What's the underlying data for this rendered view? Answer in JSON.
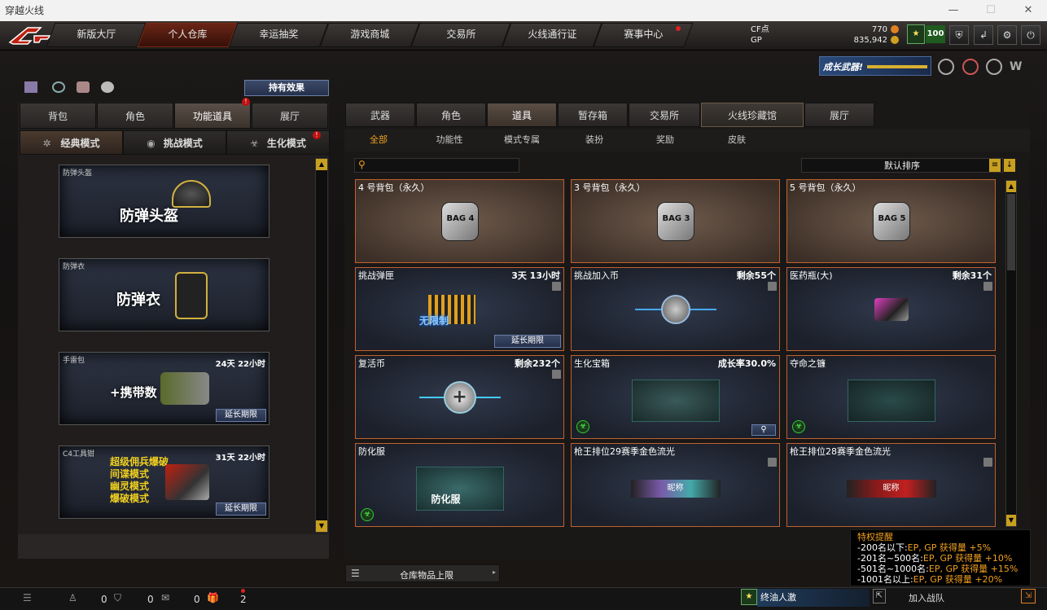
{
  "window": {
    "title": "穿越火线"
  },
  "nav": {
    "tabs": [
      "新版大厅",
      "个人仓库",
      "幸运抽奖",
      "游戏商城",
      "交易所",
      "火线通行证",
      "赛事中心"
    ],
    "active": 1
  },
  "stats": {
    "cf_label": "CF点",
    "cf_value": "770",
    "gp_label": "GP",
    "gp_value": "835,942",
    "level": "100"
  },
  "banner": {
    "text": "成长武器!"
  },
  "left": {
    "effect_button": "持有效果",
    "tabs": [
      "背包",
      "角色",
      "功能道具",
      "展厅"
    ],
    "mode_tabs": [
      "经典模式",
      "挑战模式",
      "生化模式"
    ],
    "items": [
      {
        "label": "防弹头盔",
        "big": "防弹头盔",
        "time": "",
        "extend": ""
      },
      {
        "label": "防弹衣",
        "big": "防弹衣",
        "time": "",
        "extend": ""
      },
      {
        "label": "手雷包",
        "big": "+携带数",
        "time": "24天 22小时",
        "extend": "延长期限"
      },
      {
        "label": "C4工具钳",
        "lines": [
          "超级佣兵爆破",
          "间谍模式",
          "幽灵模式",
          "爆破模式"
        ],
        "time": "31天 22小时",
        "extend": "延长期限"
      }
    ]
  },
  "right": {
    "tabs": [
      "武器",
      "角色",
      "道具",
      "暂存箱",
      "交易所",
      "火线珍藏馆",
      "展厅"
    ],
    "subtabs": [
      "全部",
      "功能性",
      "模式专属",
      "装扮",
      "奖励",
      "皮肤"
    ],
    "sort": "默认排序",
    "search_placeholder": "",
    "cards": [
      {
        "name": "4 号背包（永久）",
        "right": "",
        "badge": "BAG 4"
      },
      {
        "name": "3 号背包（永久）",
        "right": "",
        "badge": "BAG 3"
      },
      {
        "name": "5 号背包（永久）",
        "right": "",
        "badge": "BAG 5"
      },
      {
        "name": "挑战弹匣",
        "right": "3天 13小时",
        "extra": "无限制",
        "action": "延长期限"
      },
      {
        "name": "挑战加入币",
        "right": "剩余55个"
      },
      {
        "name": "医药瓶(大)",
        "right": "剩余31个"
      },
      {
        "name": "复活币",
        "right": "剩余232个"
      },
      {
        "name": "生化宝箱",
        "right": "成长率30.0%"
      },
      {
        "name": "夺命之镰",
        "right": ""
      },
      {
        "name": "防化服",
        "right": "",
        "extra": "防化服"
      },
      {
        "name": "枪王排位29赛季金色流光",
        "right": "",
        "extra": "昵称"
      },
      {
        "name": "枪王排位28赛季金色流光",
        "right": "",
        "extra": "昵称"
      }
    ],
    "storage_limit": "仓库物品上限"
  },
  "tip": {
    "title": "特权提醒",
    "lines": [
      {
        "a": "-200名以下:",
        "b": "EP, GP 获得量 +5%"
      },
      {
        "a": "-201名~500名:",
        "b": "EP, GP 获得量 +10%"
      },
      {
        "a": "-501名~1000名:",
        "b": "EP, GP 获得量 +15%"
      },
      {
        "a": "-1001名以上:",
        "b": "EP, GP 获得量 +20%"
      }
    ]
  },
  "bottom": {
    "counts": [
      "0",
      "0",
      "0",
      "2"
    ],
    "invite": "终油人激",
    "join": "加入战队"
  }
}
